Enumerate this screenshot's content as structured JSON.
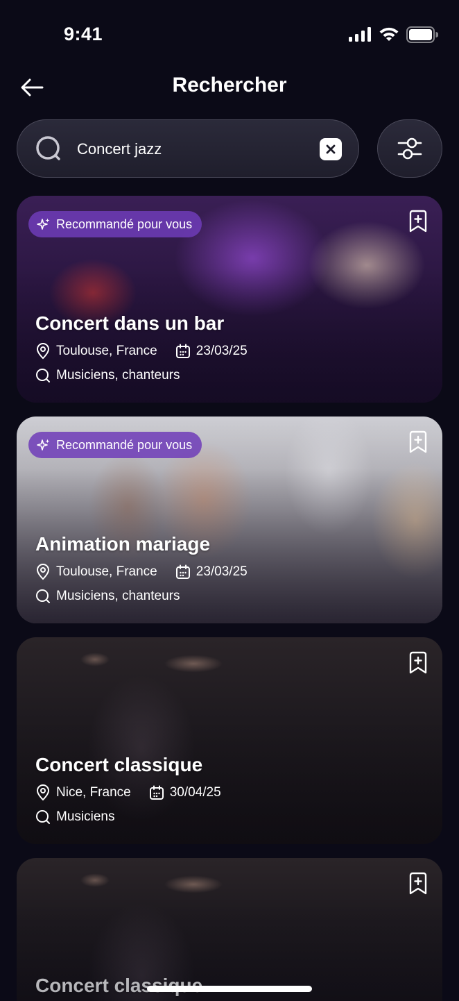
{
  "status": {
    "time": "9:41"
  },
  "header": {
    "title": "Rechercher"
  },
  "search": {
    "value": "Concert jazz"
  },
  "colors": {
    "background": "#0b0a17",
    "badge": "#6f3cb8",
    "accent_white": "#ffffff"
  },
  "cards": [
    {
      "badge": "Recommandé pour vous",
      "title": "Concert dans un bar",
      "location": "Toulouse, France",
      "date": "23/03/25",
      "roles": "Musiciens, chanteurs"
    },
    {
      "badge": "Recommandé pour vous",
      "title": "Animation mariage",
      "location": "Toulouse, France",
      "date": "23/03/25",
      "roles": "Musiciens, chanteurs"
    },
    {
      "title": "Concert classique",
      "location": "Nice, France",
      "date": "30/04/25",
      "roles": "Musiciens"
    },
    {
      "title": "Concert classique"
    }
  ],
  "icons": {
    "signal": "signal-icon",
    "wifi": "wifi-icon",
    "battery": "battery-icon",
    "back": "arrow-left-icon",
    "search": "search-icon",
    "clear": "close-icon",
    "filter": "sliders-icon",
    "sparkle": "sparkle-icon",
    "bookmark": "bookmark-add-icon",
    "location": "map-pin-icon",
    "calendar": "calendar-icon",
    "role": "search-icon"
  }
}
